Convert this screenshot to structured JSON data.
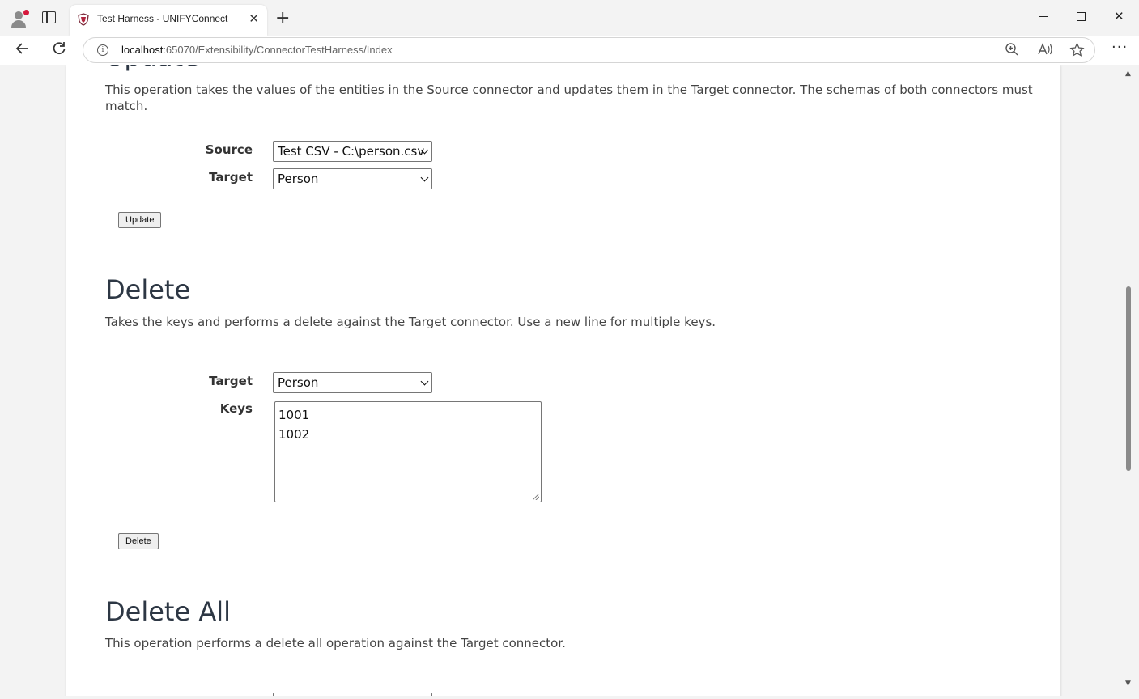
{
  "browser": {
    "tab_title": "Test Harness - UNIFYConnect",
    "url_host": "localhost",
    "url_rest": ":65070/Extensibility/ConnectorTestHarness/Index"
  },
  "update_section": {
    "heading": "Update",
    "description": "This operation takes the values of the entities in the Source connector and updates them in the Target connector. The schemas of both connectors must match.",
    "source_label": "Source",
    "source_value": "Test CSV - C:\\person.csv",
    "target_label": "Target",
    "target_value": "Person",
    "button_label": "Update"
  },
  "delete_section": {
    "heading": "Delete",
    "description": "Takes the keys and performs a delete against the Target connector. Use a new line for multiple keys.",
    "target_label": "Target",
    "target_value": "Person",
    "keys_label": "Keys",
    "keys": [
      "1001",
      "1002"
    ],
    "button_label": "Delete"
  },
  "delete_all_section": {
    "heading": "Delete All",
    "description": "This operation performs a delete all operation against the Target connector."
  }
}
